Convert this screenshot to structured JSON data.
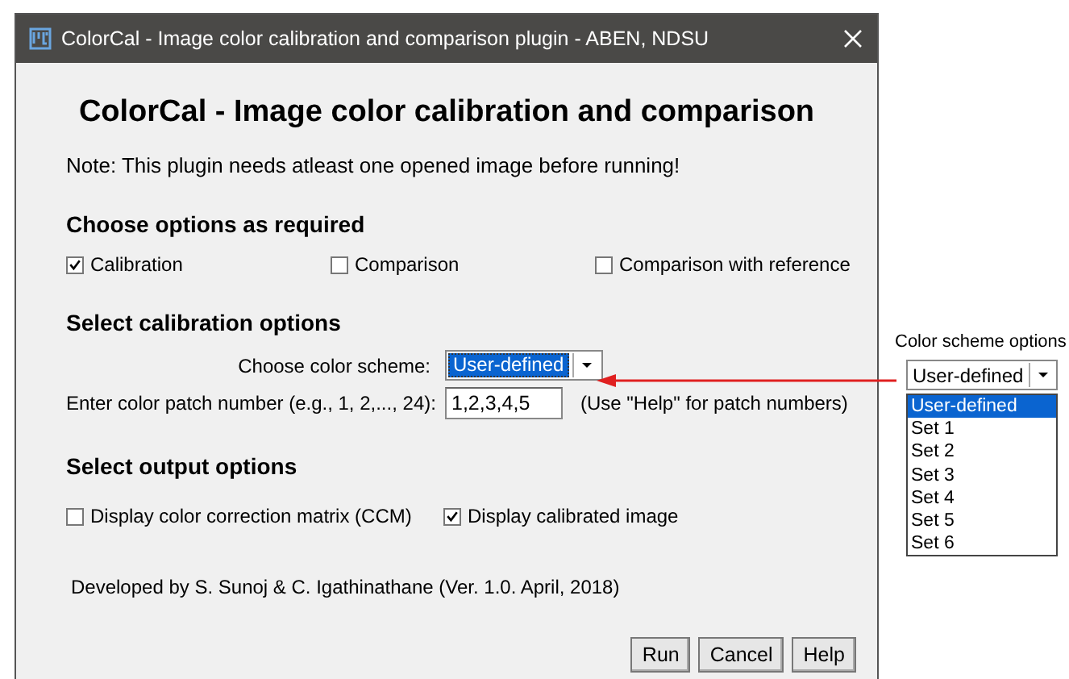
{
  "window": {
    "title": "ColorCal - Image color calibration and comparison plugin - ABEN, NDSU"
  },
  "heading": "ColorCal - Image color calibration and comparison",
  "note": "Note: This plugin needs atleast one opened image before running!",
  "options_section": {
    "title": "Choose options as required",
    "checkboxes": [
      {
        "label": "Calibration",
        "checked": true
      },
      {
        "label": "Comparison",
        "checked": false
      },
      {
        "label": "Comparison with reference",
        "checked": false
      }
    ]
  },
  "calibration_section": {
    "title": "Select calibration options",
    "scheme_label": "Choose color scheme:",
    "scheme_value": "User-defined",
    "patch_label": "Enter color patch number  (e.g., 1, 2,..., 24):",
    "patch_value": "1,2,3,4,5",
    "patch_hint": "(Use \"Help\" for patch numbers)"
  },
  "output_section": {
    "title": "Select output options",
    "checkboxes": [
      {
        "label": "Display color correction matrix (CCM)",
        "checked": false
      },
      {
        "label": "Display calibrated image",
        "checked": true
      }
    ]
  },
  "credits": "Developed by S. Sunoj & C. Igathinathane (Ver. 1.0. April, 2018)",
  "buttons": [
    "Run",
    "Cancel",
    "Help"
  ],
  "callout": {
    "title": "Color scheme options",
    "dropdown_value": "User-defined",
    "options": [
      {
        "label": "User-defined",
        "selected": true
      },
      {
        "label": "Set 1",
        "selected": false
      },
      {
        "label": "Set 2",
        "selected": false
      },
      {
        "label": "Set 3",
        "selected": false
      },
      {
        "label": "Set 4",
        "selected": false
      },
      {
        "label": "Set 5",
        "selected": false
      },
      {
        "label": "Set 6",
        "selected": false
      }
    ]
  }
}
